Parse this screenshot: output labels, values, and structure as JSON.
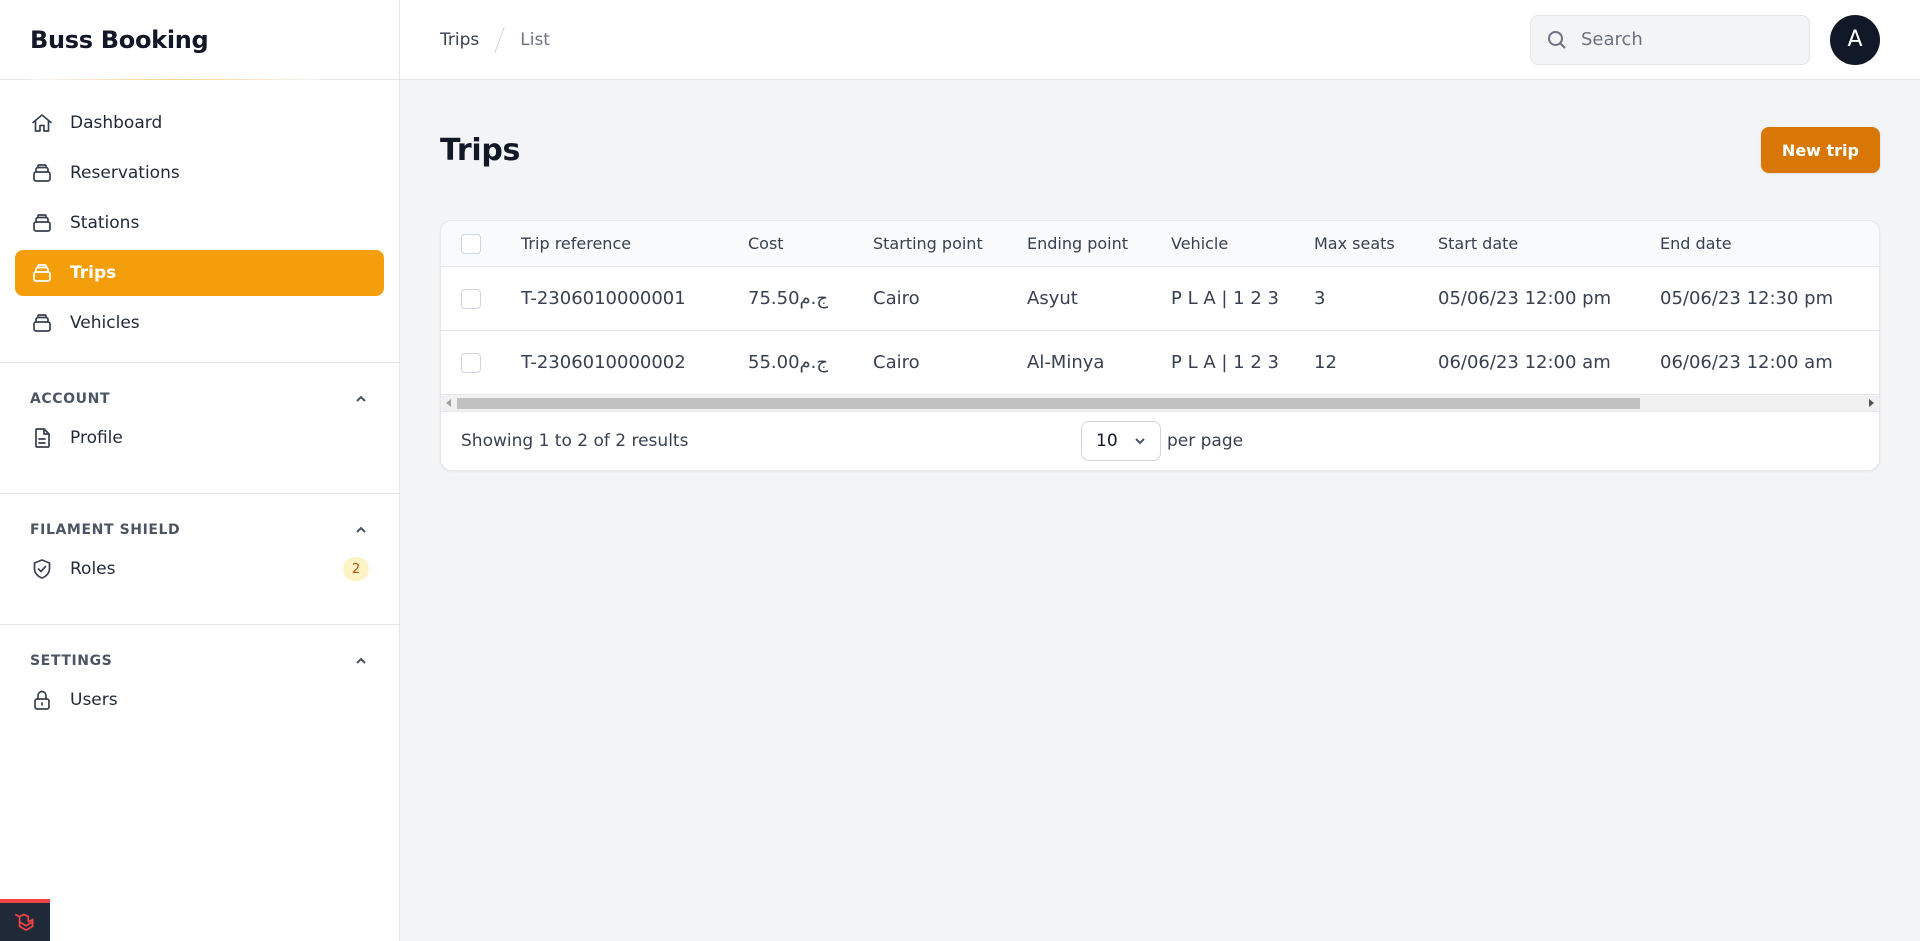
{
  "app": {
    "title": "Buss Booking"
  },
  "sidebar": {
    "items": [
      {
        "label": "Dashboard",
        "icon": "home-icon",
        "active": false
      },
      {
        "label": "Reservations",
        "icon": "collection-icon",
        "active": false
      },
      {
        "label": "Stations",
        "icon": "collection-icon",
        "active": false
      },
      {
        "label": "Trips",
        "icon": "collection-icon",
        "active": true
      },
      {
        "label": "Vehicles",
        "icon": "collection-icon",
        "active": false
      }
    ],
    "groups": [
      {
        "title": "ACCOUNT",
        "items": [
          {
            "label": "Profile",
            "icon": "document-icon"
          }
        ]
      },
      {
        "title": "FILAMENT SHIELD",
        "items": [
          {
            "label": "Roles",
            "icon": "shield-check-icon",
            "badge": "2"
          }
        ]
      },
      {
        "title": "SETTINGS",
        "items": [
          {
            "label": "Users",
            "icon": "lock-icon"
          }
        ]
      }
    ]
  },
  "topbar": {
    "breadcrumb": [
      "Trips",
      "List"
    ],
    "search_placeholder": "Search",
    "avatar_initial": "A"
  },
  "page": {
    "title": "Trips",
    "new_button": "New trip"
  },
  "table": {
    "columns": [
      "Trip reference",
      "Cost",
      "Starting point",
      "Ending point",
      "Vehicle",
      "Max seats",
      "Start date",
      "End date"
    ],
    "rows": [
      [
        "T-2306010000001",
        "75.50ج.م",
        "Cairo",
        "Asyut",
        "P L A | 1 2 3",
        "3",
        "05/06/23 12:00 pm",
        "05/06/23 12:30 pm"
      ],
      [
        "T-2306010000002",
        "55.00ج.م",
        "Cairo",
        "Al-Minya",
        "P L A | 1 2 3",
        "12",
        "06/06/23 12:00 am",
        "06/06/23 12:00 am"
      ]
    ]
  },
  "pagination": {
    "summary": "Showing 1 to 2 of 2 results",
    "per_page_value": "10",
    "per_page_label": "per page"
  },
  "colors": {
    "accent": "#f59e0b",
    "button": "#d97706"
  }
}
